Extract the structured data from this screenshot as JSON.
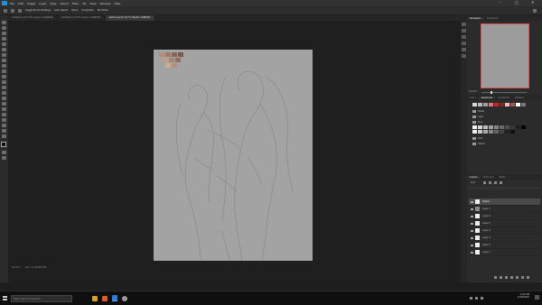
{
  "menubar": {
    "items": [
      "File",
      "Edit",
      "Image",
      "Layer",
      "Type",
      "Select",
      "Filter",
      "3D",
      "View",
      "Window",
      "Help"
    ],
    "window_controls": [
      "–",
      "□",
      "✕"
    ]
  },
  "optionsbar": {
    "buttons": [
      "Toggle Brush Settings",
      "Auto-Select",
      "Share",
      "Properties",
      "3D Mode"
    ]
  },
  "tabs": [
    {
      "label": "Untitled-1 @ 33.3% (Layer 1, RGB/8#)",
      "active": false
    },
    {
      "label": "Untitled-2 @ 50% (Layer 2, RGB/8#)",
      "active": false
    },
    {
      "label": "sketch.psd @ 16.7% (Sketch, RGB/8#)",
      "active": true
    }
  ],
  "canvas": {
    "background": "#a3a3a3",
    "swatches": [
      "#b38c7a",
      "#a17868",
      "#8a6556",
      "#c29c88",
      "#a98471",
      "#916d5e",
      "#7a594b",
      "#cfa996",
      "#b5907c"
    ]
  },
  "status": {
    "zoom": "16.67%",
    "doc_info": "Doc: 21.4M/80.8M"
  },
  "panels": {
    "navigator_tabs": [
      "Navigator",
      "Histogram"
    ],
    "zoom_value": "16.67%",
    "swatch_tabs": [
      "Color",
      "Swatches",
      "Gradients",
      "Patterns"
    ],
    "folders": [
      "Pastel",
      "Light",
      "Pure",
      "Dark",
      "Darker"
    ],
    "layer_tabs": [
      "Layers",
      "Channels",
      "Paths"
    ],
    "layer_filter": "Kind",
    "layers": [
      {
        "name": "Sketch",
        "active": true,
        "group": false
      },
      {
        "name": "Layer 7",
        "active": false,
        "group": true
      },
      {
        "name": "Layer 6",
        "active": false,
        "group": false
      },
      {
        "name": "Layer 5",
        "active": false,
        "group": false
      },
      {
        "name": "Layer 4",
        "active": false,
        "group": false
      },
      {
        "name": "Layer 3",
        "active": false,
        "group": false
      },
      {
        "name": "Layer 2",
        "active": false,
        "group": false
      },
      {
        "name": "Layer 1",
        "active": false,
        "group": false
      }
    ],
    "swatch_rows": [
      [
        "#d9d9d9",
        "#bdbdbd",
        "#9e9e9e",
        "#e57373",
        "#c62828",
        "#8e2424",
        "#f0c0c0",
        "#b05050",
        "#ffffff",
        "#777777"
      ],
      [
        "#f2f2f2",
        "#d6d6d6",
        "#bababa",
        "#a0a0a0",
        "#858585",
        "#6a6a6a",
        "#505050",
        "#383838",
        "#202020",
        "#000000"
      ]
    ]
  },
  "taskbar": {
    "search_placeholder": "Type here to search",
    "apps": [
      "#d8a030",
      "#e05a2a",
      "#2f7cd6",
      "#9a9a9a"
    ],
    "time": "2:03 PM",
    "date": "1/30/2022"
  }
}
